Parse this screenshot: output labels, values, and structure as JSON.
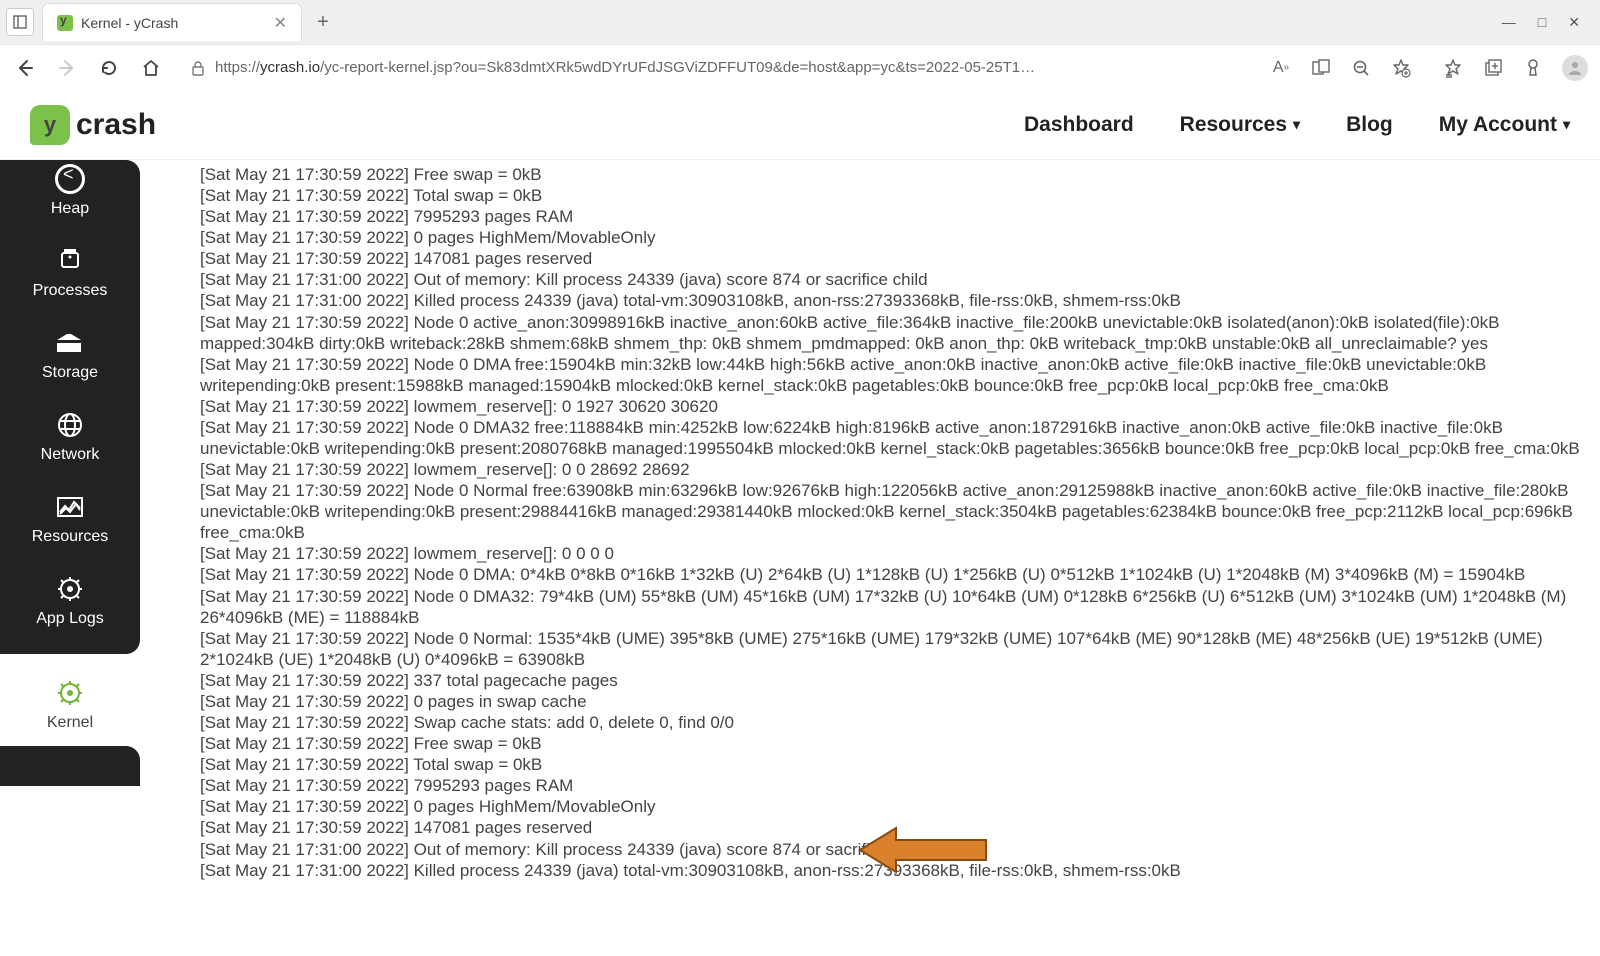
{
  "browser": {
    "tab_title": "Kernel - yCrash",
    "url_prefix": "https://",
    "url_host": "ycrash.io",
    "url_path": "/yc-report-kernel.jsp?ou=Sk83dmtXRk5wdDYrUFdJSGViZDFFUT09&de=host&app=yc&ts=2022-05-25T1…",
    "win": {
      "min": "—",
      "max": "□",
      "close": "✕"
    }
  },
  "topnav": {
    "logo_text": "crash",
    "items": [
      "Dashboard",
      "Resources",
      "Blog",
      "My Account"
    ],
    "has_caret": [
      false,
      true,
      false,
      true
    ]
  },
  "sidebar": {
    "items": [
      {
        "label": "Heap"
      },
      {
        "label": "Processes"
      },
      {
        "label": "Storage"
      },
      {
        "label": "Network"
      },
      {
        "label": "Resources"
      },
      {
        "label": "App Logs"
      }
    ],
    "active": {
      "label": "Kernel"
    }
  },
  "log_lines": [
    "[Sat May 21 17:30:59 2022] Free swap = 0kB",
    "[Sat May 21 17:30:59 2022] Total swap = 0kB",
    "[Sat May 21 17:30:59 2022] 7995293 pages RAM",
    "[Sat May 21 17:30:59 2022] 0 pages HighMem/MovableOnly",
    "[Sat May 21 17:30:59 2022] 147081 pages reserved",
    "[Sat May 21 17:31:00 2022] Out of memory: Kill process 24339 (java) score 874 or sacrifice child",
    "[Sat May 21 17:31:00 2022] Killed process 24339 (java) total-vm:30903108kB, anon-rss:27393368kB, file-rss:0kB, shmem-rss:0kB",
    "[Sat May 21 17:30:59 2022] Node 0 active_anon:30998916kB inactive_anon:60kB active_file:364kB inactive_file:200kB unevictable:0kB isolated(anon):0kB isolated(file):0kB mapped:304kB dirty:0kB writeback:28kB shmem:68kB shmem_thp: 0kB shmem_pmdmapped: 0kB anon_thp: 0kB writeback_tmp:0kB unstable:0kB all_unreclaimable? yes",
    "[Sat May 21 17:30:59 2022] Node 0 DMA free:15904kB min:32kB low:44kB high:56kB active_anon:0kB inactive_anon:0kB active_file:0kB inactive_file:0kB unevictable:0kB writepending:0kB present:15988kB managed:15904kB mlocked:0kB kernel_stack:0kB pagetables:0kB bounce:0kB free_pcp:0kB local_pcp:0kB free_cma:0kB",
    "[Sat May 21 17:30:59 2022] lowmem_reserve[]: 0 1927 30620 30620",
    "[Sat May 21 17:30:59 2022] Node 0 DMA32 free:118884kB min:4252kB low:6224kB high:8196kB active_anon:1872916kB inactive_anon:0kB active_file:0kB inactive_file:0kB unevictable:0kB writepending:0kB present:2080768kB managed:1995504kB mlocked:0kB kernel_stack:0kB pagetables:3656kB bounce:0kB free_pcp:0kB local_pcp:0kB free_cma:0kB",
    "[Sat May 21 17:30:59 2022] lowmem_reserve[]: 0 0 28692 28692",
    "[Sat May 21 17:30:59 2022] Node 0 Normal free:63908kB min:63296kB low:92676kB high:122056kB active_anon:29125988kB inactive_anon:60kB active_file:0kB inactive_file:280kB unevictable:0kB writepending:0kB present:29884416kB managed:29381440kB mlocked:0kB kernel_stack:3504kB pagetables:62384kB bounce:0kB free_pcp:2112kB local_pcp:696kB free_cma:0kB",
    "[Sat May 21 17:30:59 2022] lowmem_reserve[]: 0 0 0 0",
    "[Sat May 21 17:30:59 2022] Node 0 DMA: 0*4kB 0*8kB 0*16kB 1*32kB (U) 2*64kB (U) 1*128kB (U) 1*256kB (U) 0*512kB 1*1024kB (U) 1*2048kB (M) 3*4096kB (M) = 15904kB",
    "[Sat May 21 17:30:59 2022] Node 0 DMA32: 79*4kB (UM) 55*8kB (UM) 45*16kB (UM) 17*32kB (U) 10*64kB (UM) 0*128kB 6*256kB (U) 6*512kB (UM) 3*1024kB (UM) 1*2048kB (M) 26*4096kB (ME) = 118884kB",
    "[Sat May 21 17:30:59 2022] Node 0 Normal: 1535*4kB (UME) 395*8kB (UME) 275*16kB (UME) 179*32kB (UME) 107*64kB (ME) 90*128kB (ME) 48*256kB (UE) 19*512kB (UME) 2*1024kB (UE) 1*2048kB (U) 0*4096kB = 63908kB",
    "[Sat May 21 17:30:59 2022] 337 total pagecache pages",
    "[Sat May 21 17:30:59 2022] 0 pages in swap cache",
    "[Sat May 21 17:30:59 2022] Swap cache stats: add 0, delete 0, find 0/0",
    "[Sat May 21 17:30:59 2022] Free swap = 0kB",
    "[Sat May 21 17:30:59 2022] Total swap = 0kB",
    "[Sat May 21 17:30:59 2022] 7995293 pages RAM",
    "[Sat May 21 17:30:59 2022] 0 pages HighMem/MovableOnly",
    "[Sat May 21 17:30:59 2022] 147081 pages reserved",
    "[Sat May 21 17:31:00 2022] Out of memory: Kill process 24339 (java) score 874 or sacrifice child",
    "[Sat May 21 17:31:00 2022] Killed process 24339 (java) total-vm:30903108kB, anon-rss:27393368kB, file-rss:0kB, shmem-rss:0kB"
  ]
}
